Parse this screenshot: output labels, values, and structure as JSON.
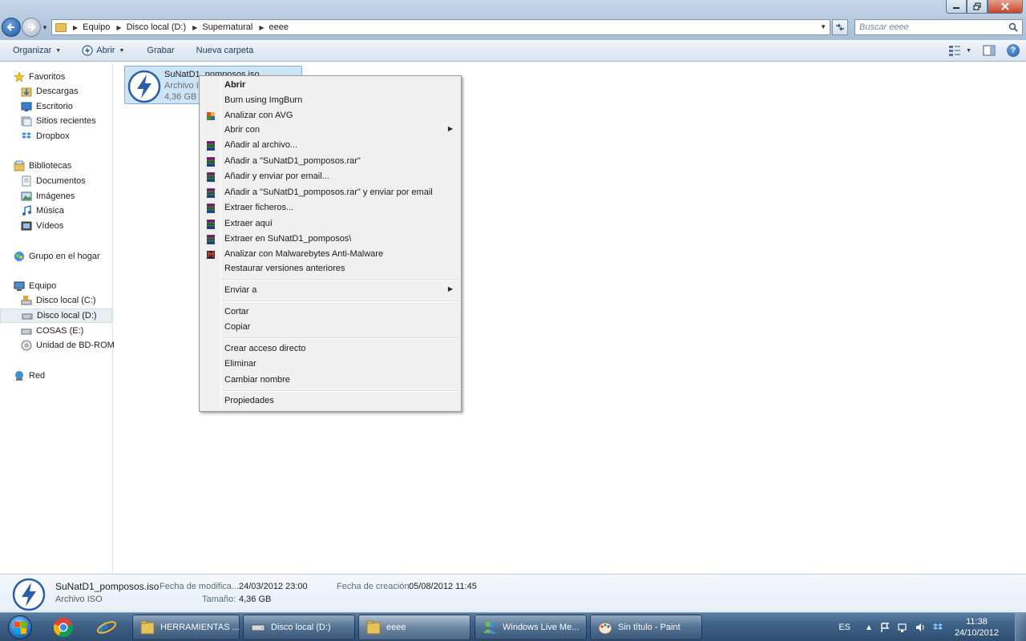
{
  "window": {
    "controls": [
      "minimize",
      "maximize",
      "close"
    ]
  },
  "address": {
    "segments": [
      "Equipo",
      "Disco local (D:)",
      "Supernatural",
      "eeee"
    ]
  },
  "search": {
    "placeholder": "Buscar eeee"
  },
  "toolbar": {
    "organize": "Organizar",
    "open": "Abrir",
    "burn": "Grabar",
    "new_folder": "Nueva carpeta"
  },
  "navpane": {
    "favorites": "Favoritos",
    "downloads": "Descargas",
    "desktop": "Escritorio",
    "recent": "Sitios recientes",
    "dropbox": "Dropbox",
    "libraries": "Bibliotecas",
    "documents": "Documentos",
    "images": "Imágenes",
    "music": "Música",
    "videos": "Vídeos",
    "homegroup": "Grupo en el hogar",
    "computer": "Equipo",
    "drive_c": "Disco local (C:)",
    "drive_d": "Disco local (D:)",
    "drive_e": "COSAS (E:)",
    "drive_bd": "Unidad de BD-ROM",
    "network": "Red"
  },
  "file": {
    "name": "SuNatD1_pomposos.iso",
    "type": "Archivo I",
    "size": "4,36 GB"
  },
  "context_menu": {
    "items": [
      "Abrir",
      "Burn using ImgBurn",
      "Analizar con AVG",
      "Abrir con",
      "Añadir al archivo...",
      "Añadir a \"SuNatD1_pomposos.rar\"",
      "Añadir y enviar por email...",
      "Añadir a \"SuNatD1_pomposos.rar\" y enviar por email",
      "Extraer ficheros...",
      "Extraer aquí",
      "Extraer en SuNatD1_pomposos\\",
      "Analizar con Malwarebytes Anti-Malware",
      "Restaurar versiones anteriores",
      "Enviar a",
      "Cortar",
      "Copiar",
      "Crear acceso directo",
      "Eliminar",
      "Cambiar nombre",
      "Propiedades"
    ]
  },
  "details": {
    "name": "SuNatD1_pomposos.iso",
    "type": "Archivo ISO",
    "modified_label": "Fecha de modifica...",
    "modified_value": "24/03/2012 23:00",
    "size_label": "Tamaño:",
    "size_value": "4,36 GB",
    "created_label": "Fecha de creación:",
    "created_value": "05/08/2012 11:45"
  },
  "taskbar": {
    "buttons": [
      "HERRAMIENTAS ...",
      "Disco local (D:)",
      "eeee",
      "Windows Live Me...",
      "Sin título - Paint"
    ],
    "language": "ES",
    "time": "11:38",
    "date": "24/10/2012"
  },
  "colors": {
    "selection": "#cde4f7",
    "accent": "#1c5aa8",
    "taskbar": "#3f6288"
  }
}
